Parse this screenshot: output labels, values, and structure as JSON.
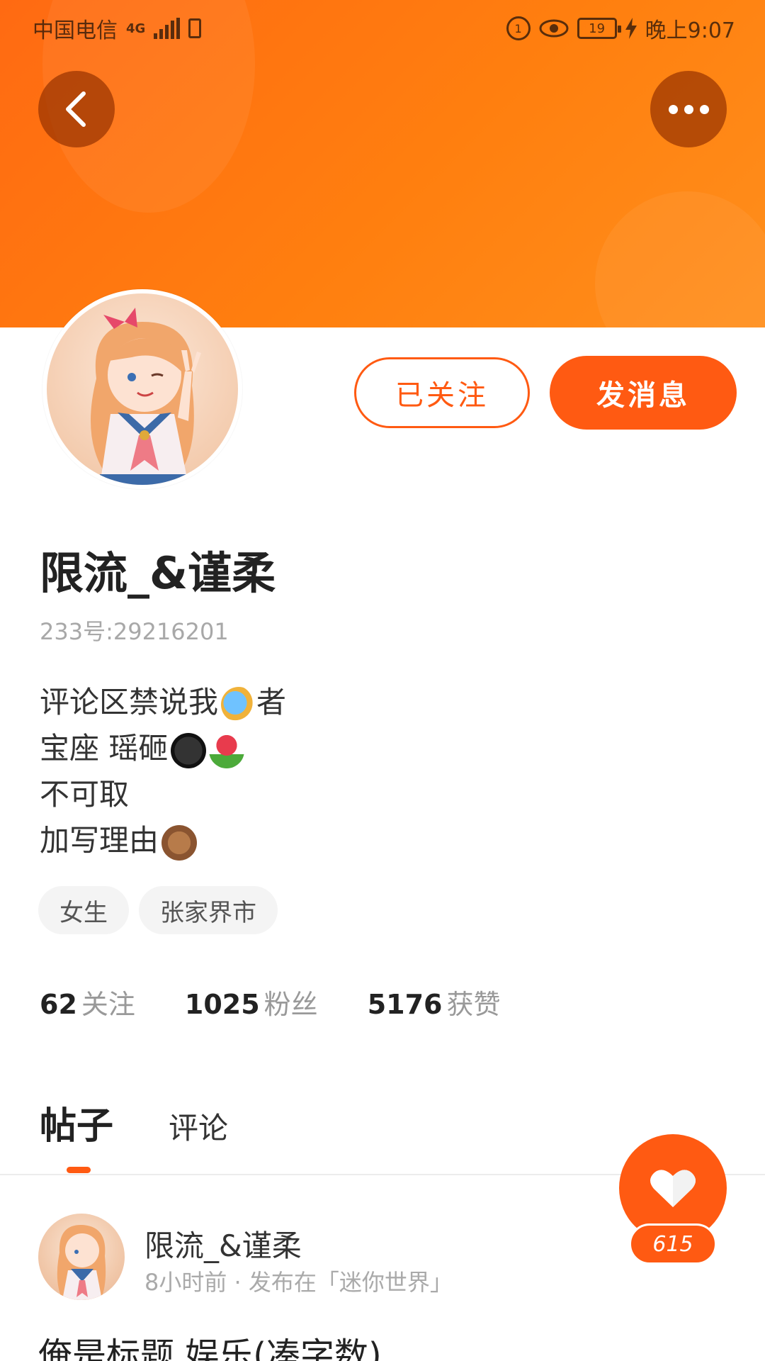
{
  "status_bar": {
    "carrier": "中国电信",
    "network": "4G",
    "battery_level": "19",
    "time": "晚上9:07"
  },
  "header": {
    "back_icon": "chevron-left-icon",
    "more_icon": "more-horizontal-icon",
    "gradient_start": "#ff6a12",
    "gradient_end": "#ff8f1c"
  },
  "profile": {
    "follow_label": "已关注",
    "message_label": "发消息",
    "username": "限流_&谨柔",
    "user_id": "233号:29216201",
    "bio_lines": [
      "评论区禁说我",
      "者",
      "宝座 瑶砸",
      "不可取",
      "加写理由"
    ],
    "tags": [
      "女生",
      "张家界市"
    ],
    "stats": [
      {
        "value": "62",
        "label": "关注"
      },
      {
        "value": "1025",
        "label": "粉丝"
      },
      {
        "value": "5176",
        "label": "获赞"
      }
    ]
  },
  "tabs": [
    {
      "label": "帖子",
      "active": true
    },
    {
      "label": "评论",
      "active": false
    }
  ],
  "post": {
    "author": "限流_&谨柔",
    "meta": "8小时前 · 发布在「迷你世界」",
    "title": "俺是标题  娱乐(凑字数)"
  },
  "like_fab": {
    "icon": "heart-icon",
    "count": "615"
  },
  "accent_color": "#ff5a12"
}
